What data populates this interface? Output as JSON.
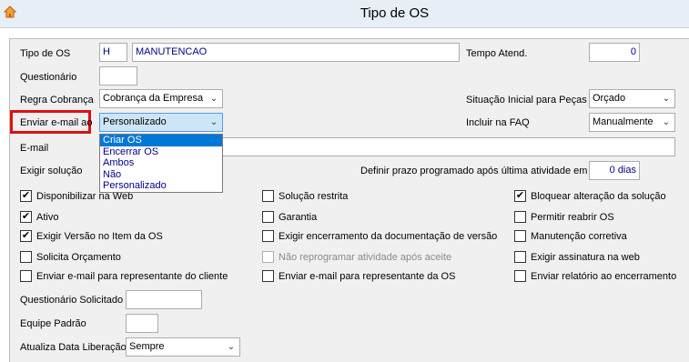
{
  "window": {
    "title": "Tipo de OS",
    "app_icon": "app-house-icon"
  },
  "fields": {
    "tipo_os_label": "Tipo de OS",
    "tipo_os_code": "H",
    "tipo_os_name": "MANUTENCAO",
    "tempo_atend_label": "Tempo Atend.",
    "tempo_atend_value": "0",
    "questionario_label": "Questionário",
    "questionario_value": "",
    "regra_cobranca_label": "Regra Cobrança",
    "regra_cobranca_value": "Cobrança da Empresa",
    "situacao_inicial_label": "Situação Inicial para Peças",
    "situacao_inicial_value": "Orçado",
    "enviar_email_label": "Enviar e-mail ao",
    "enviar_email_value": "Personalizado",
    "incluir_faq_label": "Incluir na FAQ",
    "incluir_faq_value": "Manualmente",
    "email_label": "E-mail",
    "email_value": "",
    "exigir_solucao_label": "Exigir solução",
    "prazo_label": "Definir prazo programado após última atividade em",
    "prazo_value": "0 dias",
    "questionario_solicitado_label": "Questionário Solicitado",
    "questionario_solicitado_value": "",
    "equipe_padrao_label": "Equipe Padrão",
    "equipe_padrao_value": "",
    "atualiza_data_label": "Atualiza Data Liberação",
    "atualiza_data_value": "Sempre"
  },
  "dropdown_options": [
    "Criar OS",
    "Encerrar OS",
    "Ambos",
    "Não",
    "Personalizado"
  ],
  "dropdown_highlighted": "Criar OS",
  "checkboxes": {
    "col1": [
      {
        "label": "Disponibilizar na Web",
        "checked": true
      },
      {
        "label": "Ativo",
        "checked": true
      },
      {
        "label": "Exigir Versão no Item da OS",
        "checked": true
      },
      {
        "label": "Solicita Orçamento",
        "checked": false
      },
      {
        "label": "Enviar e-mail para representante do cliente",
        "checked": false
      }
    ],
    "col2": [
      {
        "label": "Solução restrita",
        "checked": false
      },
      {
        "label": "Garantia",
        "checked": false
      },
      {
        "label": "Exigir encerramento da documentação de versão",
        "checked": false
      },
      {
        "label": "Não reprogramar atividade após aceite",
        "checked": false,
        "disabled": true
      },
      {
        "label": "Enviar e-mail para representante da OS",
        "checked": false
      }
    ],
    "col3": [
      {
        "label": "Bloquear alteração da solução",
        "checked": true
      },
      {
        "label": "Permitir reabrir OS",
        "checked": false
      },
      {
        "label": "Manutenção corretiva",
        "checked": false
      },
      {
        "label": "Exigir assinatura na web",
        "checked": false
      },
      {
        "label": "Enviar relatório ao encerramento",
        "checked": false
      }
    ]
  },
  "colors": {
    "highlight_border": "#e01010",
    "selected_option": "#0078d7",
    "value_text": "#00008b"
  }
}
